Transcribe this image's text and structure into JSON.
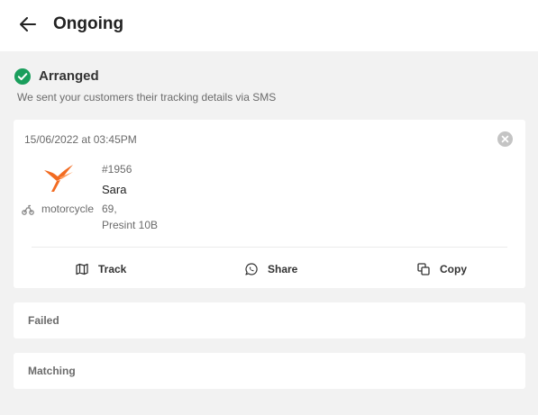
{
  "header": {
    "title": "Ongoing",
    "back_icon": "arrow-left-icon"
  },
  "status": {
    "title": "Arranged",
    "subtitle": "We sent your customers their tracking details via SMS",
    "icon": "check-circle-icon",
    "color": "#1a9e5c"
  },
  "order": {
    "datetime": "15/06/2022 at 03:45PM",
    "id": "#1956",
    "customer": "Sara",
    "address_line1": "69,",
    "address_line2": "Presint 10B",
    "vehicle": "motorcycle",
    "courier_logo": "hummingbird-logo",
    "logo_color": "#f26b21"
  },
  "actions": [
    {
      "label": "Track",
      "icon": "map-icon"
    },
    {
      "label": "Share",
      "icon": "whatsapp-icon"
    },
    {
      "label": "Copy",
      "icon": "copy-icon"
    }
  ],
  "sections": [
    {
      "label": "Failed"
    },
    {
      "label": "Matching"
    }
  ]
}
